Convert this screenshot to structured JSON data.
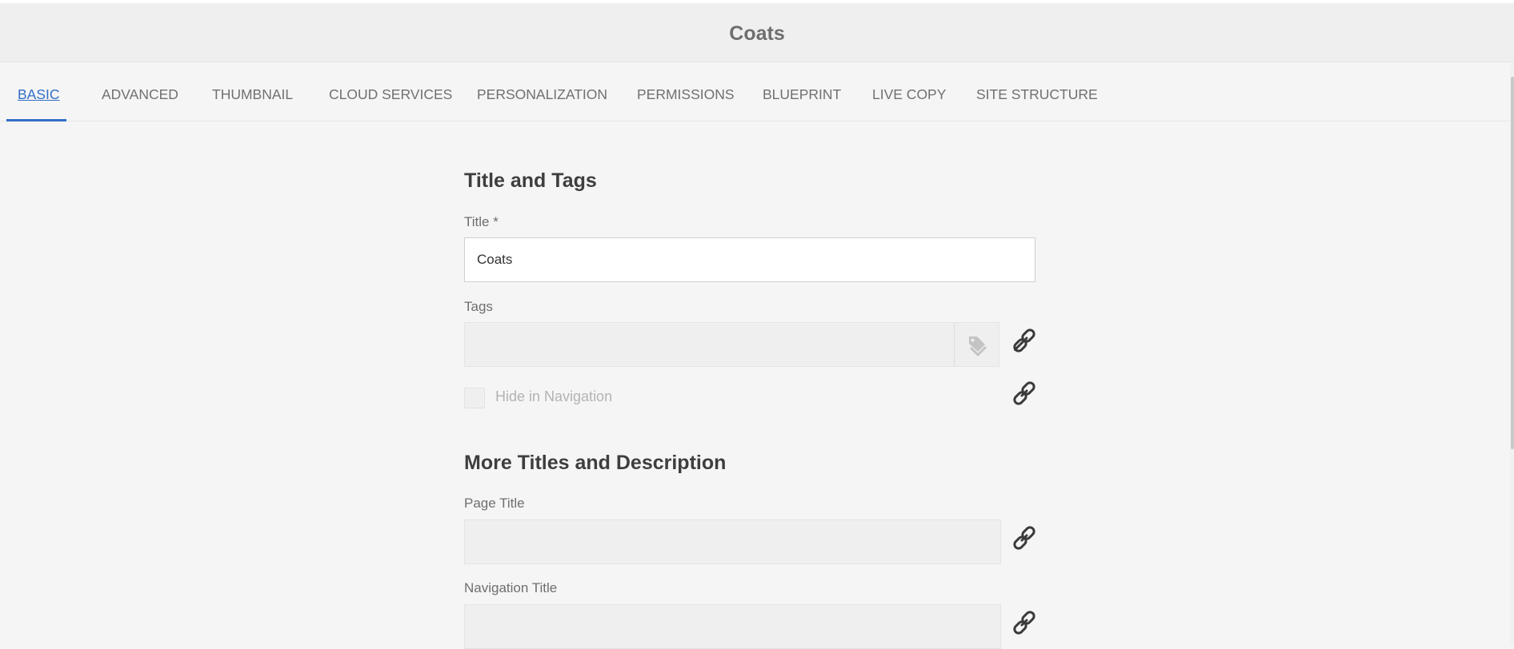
{
  "header": {
    "title": "Coats"
  },
  "tabs": [
    {
      "label": "BASIC",
      "active": true
    },
    {
      "label": "ADVANCED",
      "active": false
    },
    {
      "label": "THUMBNAIL",
      "active": false
    },
    {
      "label": "CLOUD SERVICES",
      "active": false
    },
    {
      "label": "PERSONALIZATION",
      "active": false
    },
    {
      "label": "PERMISSIONS",
      "active": false
    },
    {
      "label": "BLUEPRINT",
      "active": false
    },
    {
      "label": "LIVE COPY",
      "active": false
    },
    {
      "label": "SITE STRUCTURE",
      "active": false
    }
  ],
  "sections": {
    "title_tags": {
      "heading": "Title and Tags",
      "title_label": "Title *",
      "title_value": "Coats",
      "tags_label": "Tags",
      "tags_value": "",
      "hide_in_navigation_label": "Hide in Navigation",
      "hide_in_navigation_checked": false
    },
    "more_titles": {
      "heading": "More Titles and Description",
      "page_title_label": "Page Title",
      "page_title_value": "",
      "navigation_title_label": "Navigation Title",
      "navigation_title_value": ""
    }
  },
  "icons": {
    "tag": "tag-icon",
    "link": "link-icon"
  },
  "colors": {
    "accent": "#326ec8",
    "header_bg": "#efefef",
    "page_bg": "#f5f5f5",
    "tab_text": "#707070"
  }
}
